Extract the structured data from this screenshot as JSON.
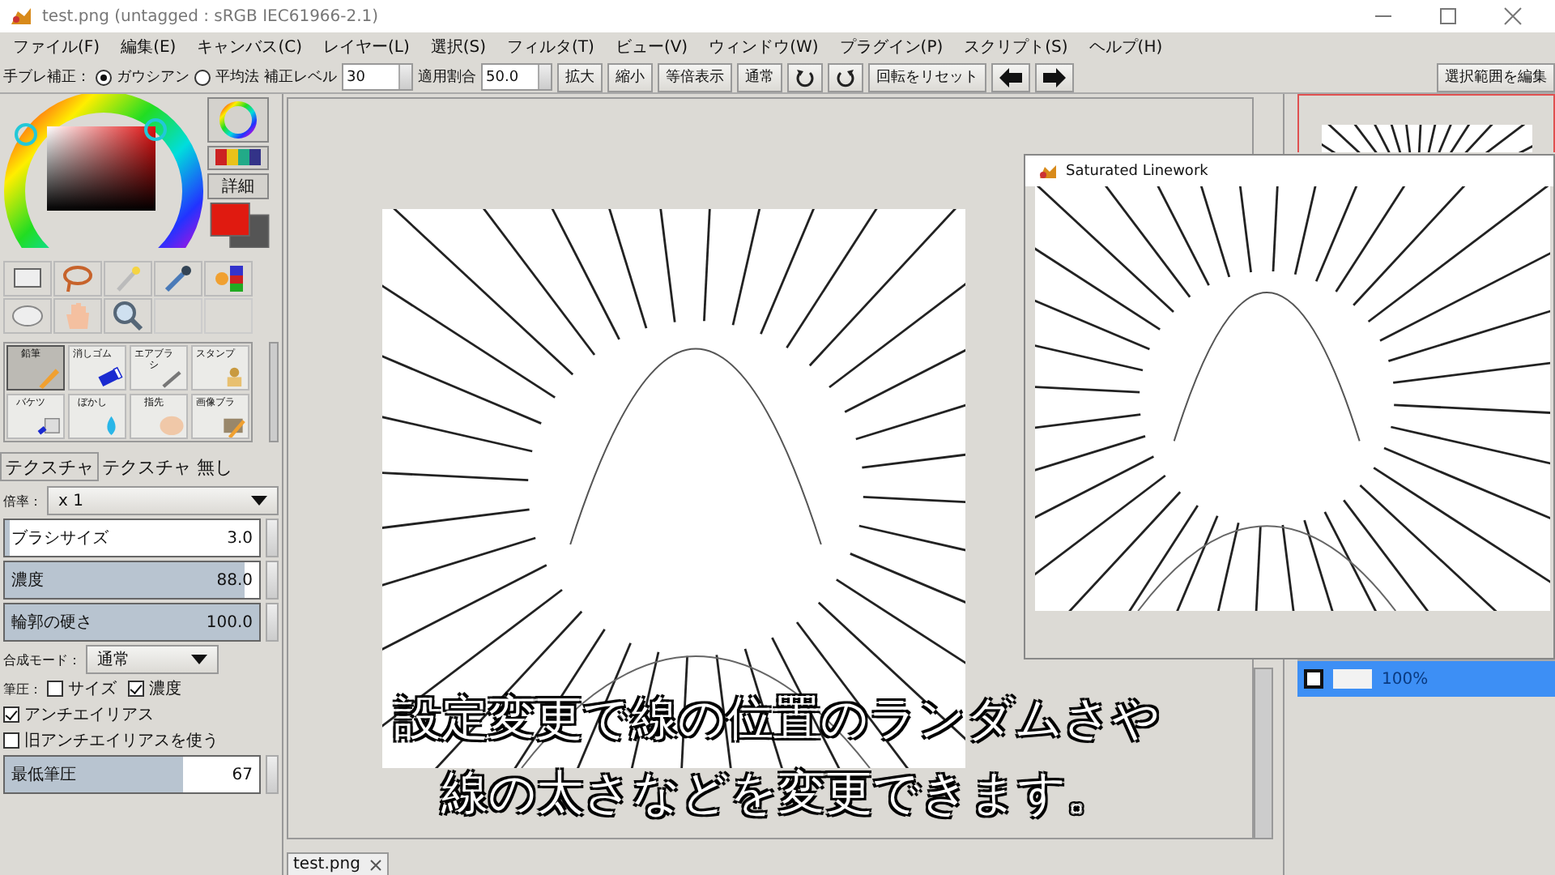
{
  "window": {
    "title": "test.png (untagged : sRGB IEC61966-2.1)"
  },
  "menu": [
    {
      "label": "ファイル(F)"
    },
    {
      "label": "編集(E)"
    },
    {
      "label": "キャンバス(C)"
    },
    {
      "label": "レイヤー(L)"
    },
    {
      "label": "選択(S)"
    },
    {
      "label": "フィルタ(T)"
    },
    {
      "label": "ビュー(V)"
    },
    {
      "label": "ウィンドウ(W)"
    },
    {
      "label": "プラグイン(P)"
    },
    {
      "label": "スクリプト(S)"
    },
    {
      "label": "ヘルプ(H)"
    }
  ],
  "toolbar": {
    "stabilizer_label": "手ブレ補正：",
    "methods": [
      {
        "label": "ガウシアン",
        "selected": true
      },
      {
        "label": "平均法",
        "selected": false
      }
    ],
    "level_label": "補正レベル",
    "level_value": "30",
    "ratio_label": "適用割合",
    "ratio_value": "50.0",
    "view_buttons": [
      "拡大",
      "縮小",
      "等倍表示",
      "通常"
    ],
    "reset_rotation": "回転をリセット",
    "edit_selection": "選択範囲を編集"
  },
  "color_panel": {
    "detail_button": "詳細"
  },
  "brushes": [
    {
      "label": "鉛筆",
      "selected": true
    },
    {
      "label": "消しゴム",
      "selected": false
    },
    {
      "label": "エアブラシ",
      "selected": false
    },
    {
      "label": "スタンプ",
      "selected": false
    },
    {
      "label": "バケツ",
      "selected": false
    },
    {
      "label": "ぼかし",
      "selected": false
    },
    {
      "label": "指先",
      "selected": false
    },
    {
      "label": "画像ブラ",
      "selected": false
    }
  ],
  "texture": {
    "tab": "テクスチャ",
    "value": "テクスチャ 無し"
  },
  "magnification": {
    "label": "倍率：",
    "value": "x 1"
  },
  "sliders": [
    {
      "label": "ブラシサイズ",
      "reading": "3.0",
      "level": 0.02
    },
    {
      "label": "濃度",
      "reading": "88.0",
      "level": 0.94
    },
    {
      "label": "輪郭の硬さ",
      "reading": "100.0",
      "level": 1
    }
  ],
  "blend_mode": {
    "label": "合成モード：",
    "value": "通常"
  },
  "pressure": {
    "label": "筆圧：",
    "options": [
      {
        "label": "サイズ",
        "checked": false
      },
      {
        "label": "濃度",
        "checked": true
      }
    ]
  },
  "options": [
    {
      "label": "アンチエイリアス",
      "checked": true
    },
    {
      "label": "旧アンチエイリアスを使う",
      "checked": false
    }
  ],
  "min_pressure": {
    "label": "最低筆圧",
    "reading": "67",
    "level": 0.7
  },
  "document_tab": "test.png",
  "preview_window": {
    "title": "Saturated Linework"
  },
  "layers": [
    {
      "opacity": "100%",
      "selected": true
    }
  ],
  "subtitles": [
    "設定変更で線の位置のランダムさや",
    "線の太さなどを変更できます。"
  ]
}
